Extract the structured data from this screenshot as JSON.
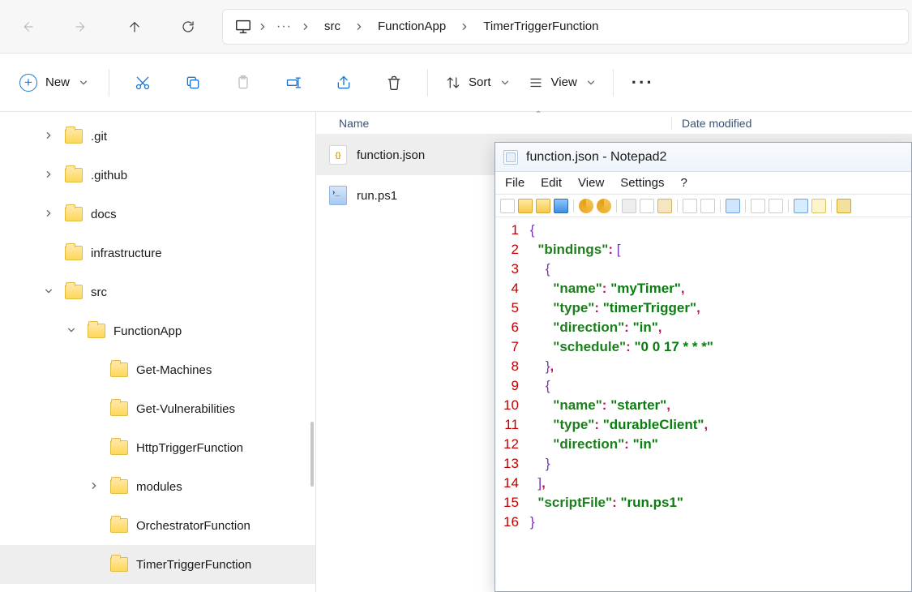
{
  "breadcrumbs": [
    "src",
    "FunctionApp",
    "TimerTriggerFunction"
  ],
  "toolbar": {
    "new_label": "New",
    "sort_label": "Sort",
    "view_label": "View"
  },
  "columns": {
    "name": "Name",
    "date": "Date modified"
  },
  "tree": [
    {
      "depth": 1,
      "twisty": "›",
      "selected": false,
      "name": ".git"
    },
    {
      "depth": 1,
      "twisty": "›",
      "selected": false,
      "name": ".github"
    },
    {
      "depth": 1,
      "twisty": "›",
      "selected": false,
      "name": "docs"
    },
    {
      "depth": 1,
      "twisty": "",
      "selected": false,
      "name": "infrastructure"
    },
    {
      "depth": 1,
      "twisty": "⌄",
      "selected": false,
      "name": "src"
    },
    {
      "depth": 2,
      "twisty": "⌄",
      "selected": false,
      "name": "FunctionApp"
    },
    {
      "depth": 3,
      "twisty": "",
      "selected": false,
      "name": "Get-Machines"
    },
    {
      "depth": 3,
      "twisty": "",
      "selected": false,
      "name": "Get-Vulnerabilities"
    },
    {
      "depth": 3,
      "twisty": "",
      "selected": false,
      "name": "HttpTriggerFunction"
    },
    {
      "depth": 3,
      "twisty": "›",
      "selected": false,
      "name": "modules"
    },
    {
      "depth": 3,
      "twisty": "",
      "selected": false,
      "name": "OrchestratorFunction"
    },
    {
      "depth": 3,
      "twisty": "",
      "selected": true,
      "name": "TimerTriggerFunction"
    }
  ],
  "files": [
    {
      "name": "function.json",
      "selected": true,
      "kind": "json"
    },
    {
      "name": "run.ps1",
      "selected": false,
      "kind": "ps1"
    }
  ],
  "notepad2": {
    "title": "function.json - Notepad2",
    "menus": [
      "File",
      "Edit",
      "View",
      "Settings",
      "?"
    ],
    "code_lines": [
      [
        {
          "c": "brace",
          "t": "{"
        }
      ],
      [
        {
          "c": "",
          "t": "  "
        },
        {
          "c": "key",
          "t": "\"bindings\""
        },
        {
          "c": "punc",
          "t": ": "
        },
        {
          "c": "brace",
          "t": "["
        }
      ],
      [
        {
          "c": "",
          "t": "    "
        },
        {
          "c": "brace",
          "t": "{"
        }
      ],
      [
        {
          "c": "",
          "t": "      "
        },
        {
          "c": "key",
          "t": "\"name\""
        },
        {
          "c": "punc",
          "t": ": "
        },
        {
          "c": "str",
          "t": "\"myTimer\""
        },
        {
          "c": "punc",
          "t": ","
        }
      ],
      [
        {
          "c": "",
          "t": "      "
        },
        {
          "c": "key",
          "t": "\"type\""
        },
        {
          "c": "punc",
          "t": ": "
        },
        {
          "c": "str",
          "t": "\"timerTrigger\""
        },
        {
          "c": "punc",
          "t": ","
        }
      ],
      [
        {
          "c": "",
          "t": "      "
        },
        {
          "c": "key",
          "t": "\"direction\""
        },
        {
          "c": "punc",
          "t": ": "
        },
        {
          "c": "str",
          "t": "\"in\""
        },
        {
          "c": "punc",
          "t": ","
        }
      ],
      [
        {
          "c": "",
          "t": "      "
        },
        {
          "c": "key",
          "t": "\"schedule\""
        },
        {
          "c": "punc",
          "t": ": "
        },
        {
          "c": "str",
          "t": "\"0 0 17 * * *\""
        }
      ],
      [
        {
          "c": "",
          "t": "    "
        },
        {
          "c": "brace",
          "t": "}"
        },
        {
          "c": "punc",
          "t": ","
        }
      ],
      [
        {
          "c": "",
          "t": "    "
        },
        {
          "c": "brace",
          "t": "{"
        }
      ],
      [
        {
          "c": "",
          "t": "      "
        },
        {
          "c": "key",
          "t": "\"name\""
        },
        {
          "c": "punc",
          "t": ": "
        },
        {
          "c": "str",
          "t": "\"starter\""
        },
        {
          "c": "punc",
          "t": ","
        }
      ],
      [
        {
          "c": "",
          "t": "      "
        },
        {
          "c": "key",
          "t": "\"type\""
        },
        {
          "c": "punc",
          "t": ": "
        },
        {
          "c": "str",
          "t": "\"durableClient\""
        },
        {
          "c": "punc",
          "t": ","
        }
      ],
      [
        {
          "c": "",
          "t": "      "
        },
        {
          "c": "key",
          "t": "\"direction\""
        },
        {
          "c": "punc",
          "t": ": "
        },
        {
          "c": "str",
          "t": "\"in\""
        }
      ],
      [
        {
          "c": "",
          "t": "    "
        },
        {
          "c": "brace",
          "t": "}"
        }
      ],
      [
        {
          "c": "",
          "t": "  "
        },
        {
          "c": "brace",
          "t": "]"
        },
        {
          "c": "punc",
          "t": ","
        }
      ],
      [
        {
          "c": "",
          "t": "  "
        },
        {
          "c": "key",
          "t": "\"scriptFile\""
        },
        {
          "c": "punc",
          "t": ": "
        },
        {
          "c": "str",
          "t": "\"run.ps1\""
        }
      ],
      [
        {
          "c": "brace",
          "t": "}"
        }
      ]
    ]
  }
}
